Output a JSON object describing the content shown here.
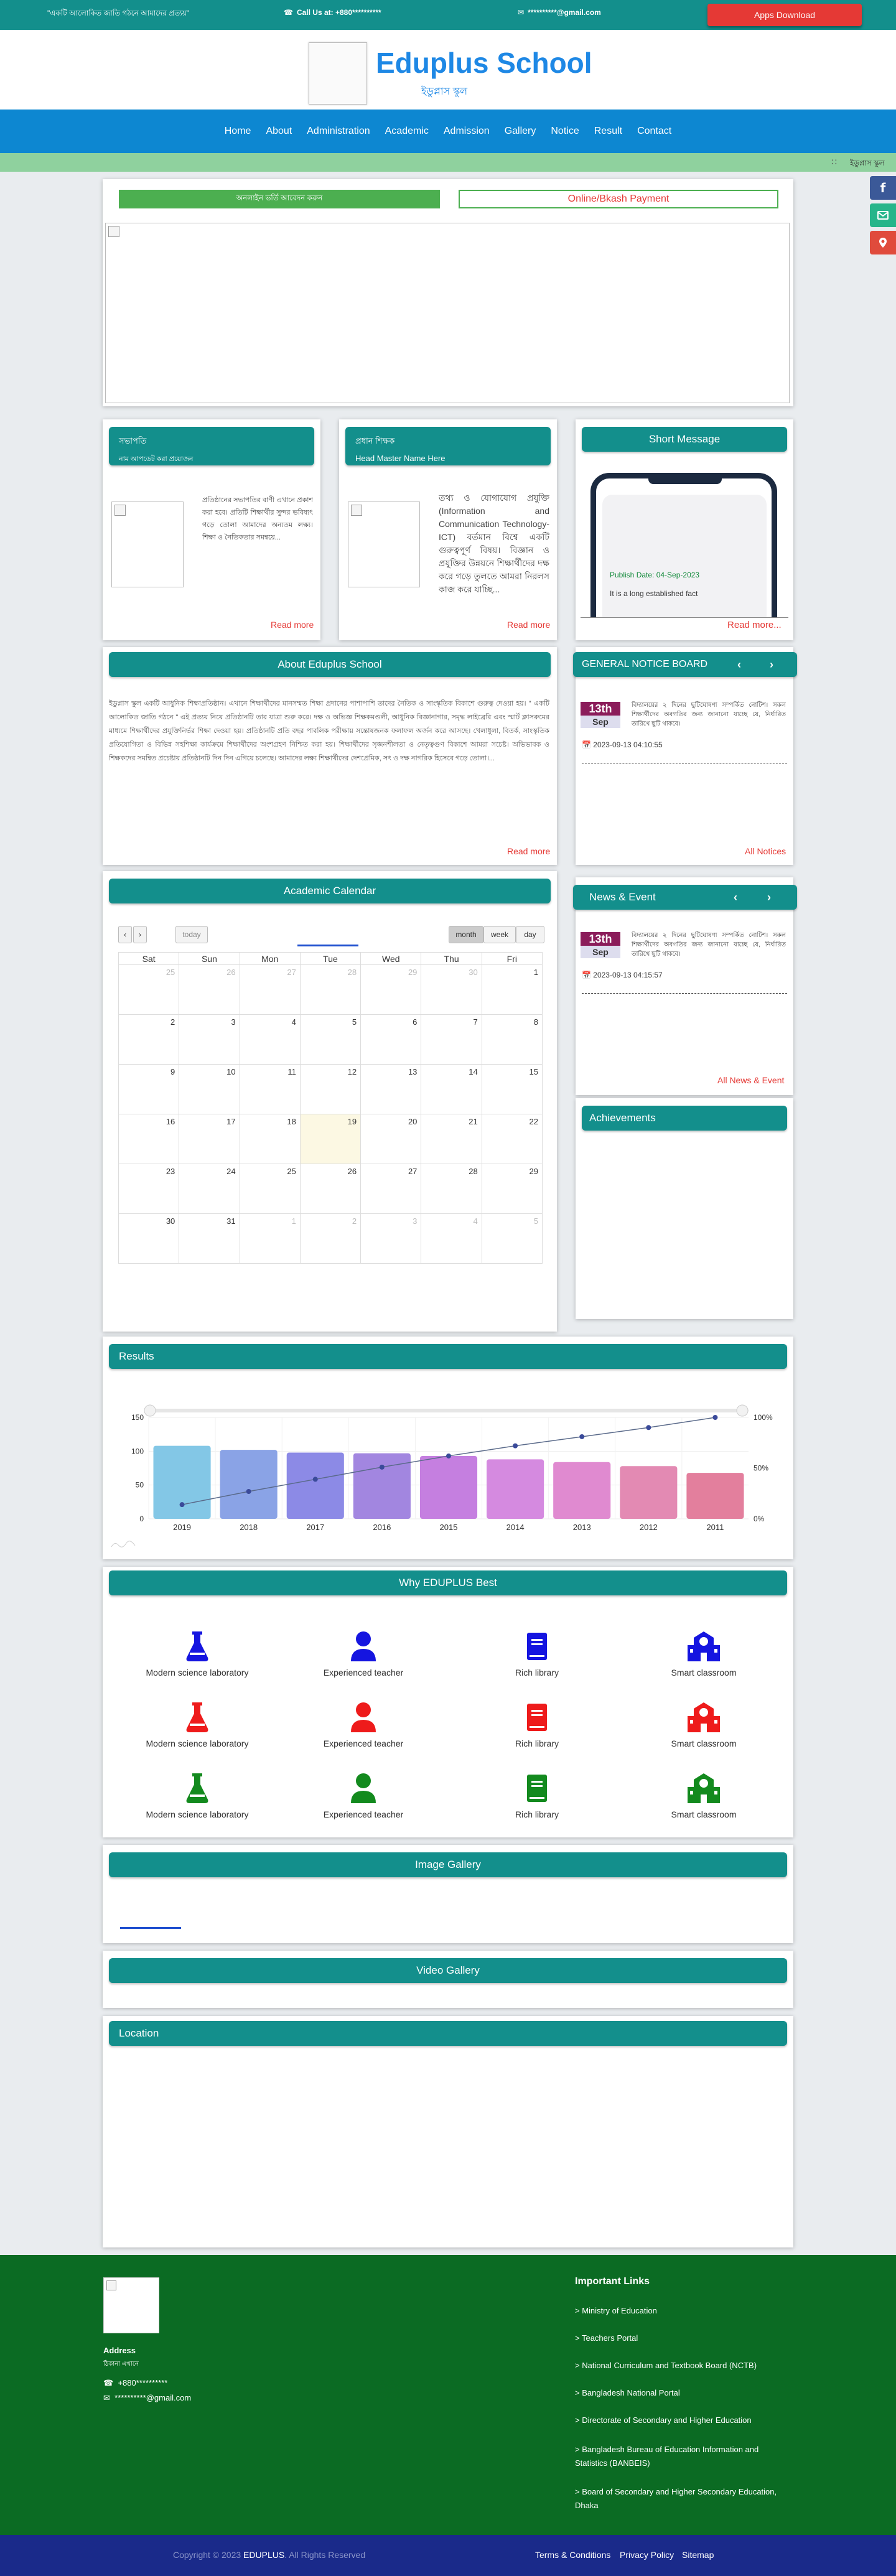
{
  "topbar": {
    "tagline": "\"একটি আলোকিত জাতি গঠনে আমাদের প্রত্যয়\"",
    "call_label": "Call Us at: +880**********",
    "email": "**********@gmail.com",
    "apps_button": "Apps Download"
  },
  "brand": {
    "name": "Eduplus School",
    "subname": "ইডুপ্লাস স্কুল"
  },
  "nav": [
    "Home",
    "About",
    "Administration",
    "Academic",
    "Admission",
    "Gallery",
    "Notice",
    "Result",
    "Contact"
  ],
  "marquee": {
    "text": "ইডুপ্লাস স্কুল"
  },
  "actions": {
    "online_admission": "অনলাইন ভর্তি আবেদন করুন",
    "payment": "Online/Bkash Payment"
  },
  "president": {
    "title": "সভাপতি",
    "subtitle": "নাম আপডেট করা প্রয়োজন",
    "text": "প্রতিষ্ঠানের সভাপতির বাণী এখানে প্রকাশ করা হবে। প্রতিটি শিক্ষার্থীর সুন্দর ভবিষ্যৎ গড়ে তোলা আমাদের অন্যতম লক্ষ্য। শিক্ষা ও নৈতিকতার সমন্বয়ে...",
    "read_more": "Read more"
  },
  "headmaster": {
    "title": "প্রধান শিক্ষক",
    "subtitle": "Head Master Name Here",
    "text": "তথ্য ও যোগাযোগ প্রযুক্তি (Information and Communication Technology-ICT) বর্তমান বিশ্বে একটি গুরুত্বপূর্ণ বিষয়। বিজ্ঞান ও প্রযুক্তির উন্নয়নে শিক্ষার্থীদের দক্ষ করে গড়ে তুলতে আমরা নিরলস কাজ করে যাচ্ছি...",
    "read_more": "Read more"
  },
  "short_message": {
    "title": "Short Message",
    "publish": "Publish Date: 04-Sep-2023",
    "text": "It is a long established fact",
    "read_more": "Read more..."
  },
  "about": {
    "title": "About Eduplus School",
    "text": "ইডুপ্লাস স্কুল একটি আধুনিক শিক্ষাপ্রতিষ্ঠান। এখানে শিক্ষার্থীদের মানসম্মত শিক্ষা প্রদানের পাশাপাশি তাদের নৈতিক ও সাংস্কৃতিক বিকাশে গুরুত্ব দেওয়া হয়। \" একটি আলোকিত জাতি গঠনে \" এই প্রত্যয় নিয়ে প্রতিষ্ঠানটি তার যাত্রা শুরু করে। দক্ষ ও অভিজ্ঞ শিক্ষকমণ্ডলী, আধুনিক বিজ্ঞানাগার, সমৃদ্ধ লাইব্রেরি এবং স্মার্ট ক্লাসরুমের মাধ্যমে শিক্ষার্থীদের প্রযুক্তিনির্ভর শিক্ষা দেওয়া হয়। প্রতিষ্ঠানটি প্রতি বছর পাবলিক পরীক্ষায় সন্তোষজনক ফলাফল অর্জন করে আসছে। খেলাধুলা, বিতর্ক, সাংস্কৃতিক প্রতিযোগিতা ও বিভিন্ন সহশিক্ষা কার্যক্রমে শিক্ষার্থীদের অংশগ্রহণ নিশ্চিত করা হয়। শিক্ষার্থীদের সৃজনশীলতা ও নেতৃত্বগুণ বিকাশে আমরা সচেষ্ট। অভিভাবক ও শিক্ষকদের সমন্বিত প্রচেষ্টায় প্রতিষ্ঠানটি দিন দিন এগিয়ে চলেছে। আমাদের লক্ষ্য শিক্ষার্থীদের দেশপ্রেমিক, সৎ ও দক্ষ নাগরিক হিসেবে গড়ে তোলা।...",
    "read_more": "Read more"
  },
  "notice_board": {
    "title": "GENERAL NOTICE BOARD",
    "day": "13th",
    "month": "Sep",
    "text": "বিদ্যালয়ের ২ দিনের ছুটিঘোষণা সম্পর্কিত নোটিশ। সকল শিক্ষার্থীদের অবগতির জন্য জানানো যাচ্ছে যে, নির্ধারিত তারিখে ছুটি থাকবে।",
    "time": "2023-09-13 04:10:55",
    "all": "All Notices"
  },
  "news": {
    "title": "News & Event",
    "day": "13th",
    "month": "Sep",
    "text": "বিদ্যালয়ের ২ দিনের ছুটিঘোষণা সম্পর্কিত নোটিশ। সকল শিক্ষার্থীদের অবগতির জন্য জানানো যাচ্ছে যে, নির্ধারিত তারিখে ছুটি থাকবে।",
    "time": "2023-09-13 04:15:57",
    "all": "All News & Event"
  },
  "calendar": {
    "title": "Academic Calendar",
    "today": "today",
    "month": "month",
    "week": "week",
    "day": "day",
    "weekdays": [
      "Sat",
      "Sun",
      "Mon",
      "Tue",
      "Wed",
      "Thu",
      "Fri"
    ],
    "weeks": [
      [
        "25",
        "26",
        "27",
        "28",
        "29",
        "30",
        "1"
      ],
      [
        "2",
        "3",
        "4",
        "5",
        "6",
        "7",
        "8"
      ],
      [
        "9",
        "10",
        "11",
        "12",
        "13",
        "14",
        "15"
      ],
      [
        "16",
        "17",
        "18",
        "19",
        "20",
        "21",
        "22"
      ],
      [
        "23",
        "24",
        "25",
        "26",
        "27",
        "28",
        "29"
      ],
      [
        "30",
        "31",
        "1",
        "2",
        "3",
        "4",
        "5"
      ]
    ]
  },
  "achievements": {
    "title": "Achievements"
  },
  "results": {
    "title": "Results"
  },
  "chart_data": {
    "type": "bar",
    "categories": [
      "2019",
      "2018",
      "2017",
      "2016",
      "2015",
      "2014",
      "2013",
      "2012",
      "2011"
    ],
    "series": [
      {
        "values": [
          108,
          102,
          98,
          97,
          93,
          88,
          84,
          78,
          68
        ]
      },
      {
        "values": [
          14,
          27,
          39,
          51,
          62,
          72,
          81,
          90,
          100
        ]
      }
    ],
    "ylim": [
      0,
      150
    ],
    "y_ticks": [
      "0",
      "50",
      "100",
      "150"
    ],
    "y2_ticks": [
      "0%",
      "50%",
      "100%"
    ],
    "colors": [
      "#83c7e6",
      "#8aa3e6",
      "#8c8ae6",
      "#a286e0",
      "#c57fe0",
      "#d58ae0",
      "#e08ad0",
      "#e38ab3",
      "#e37f9d"
    ]
  },
  "why": {
    "title": "Why EDUPLUS Best",
    "rows": [
      {
        "color": "#1515e0",
        "items": [
          "Modern science laboratory",
          "Experienced teacher",
          "Rich library",
          "Smart classroom"
        ]
      },
      {
        "color": "#ee1b1b",
        "items": [
          "Modern science laboratory",
          "Experienced teacher",
          "Rich library",
          "Smart classroom"
        ]
      },
      {
        "color": "#138a1e",
        "items": [
          "Modern science laboratory",
          "Experienced teacher",
          "Rich library",
          "Smart classroom"
        ]
      }
    ]
  },
  "gallery": {
    "title": "Image Gallery"
  },
  "video": {
    "title": "Video Gallery"
  },
  "location": {
    "title": "Location"
  },
  "footer": {
    "address_title": "Address",
    "address": "ঠিকানা এখানে",
    "phone": "+880**********",
    "email": "**********@gmail.com",
    "links_title": "Important Links",
    "links": [
      "> Ministry of Education",
      "> Teachers Portal",
      "> National Curriculum and Textbook Board (NCTB)",
      "> Bangladesh National Portal",
      "> Directorate of Secondary and Higher Education",
      "> Bangladesh Bureau of Education Information and Statistics (BANBEIS)",
      "> Board of Secondary and Higher Secondary Education, Dhaka"
    ]
  },
  "bottombar": {
    "copyright_pre": "Copyright © 2023",
    "brand": "EDUPLUS",
    "copyright_post": ". All Rights Reserved",
    "terms": "Terms & Conditions",
    "privacy": "Privacy Policy",
    "sitemap": "Sitemap"
  }
}
